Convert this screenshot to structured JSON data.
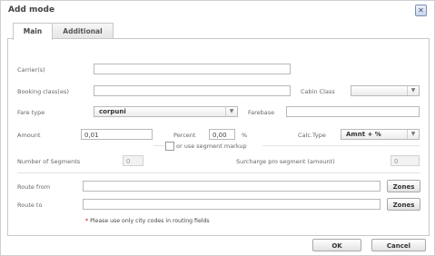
{
  "dialog": {
    "title": "Add mode",
    "close_symbol": "✕"
  },
  "tabs": [
    {
      "label": "Main",
      "active": true
    },
    {
      "label": "Additional",
      "active": false
    }
  ],
  "form": {
    "carriers_label": "Carrier(s)",
    "booking_label": "Booking class(es)",
    "cabin_class_label": "Cabin Class",
    "cabin_class_value": "",
    "fare_type_label": "Fare type",
    "fare_type_value": "corpuni",
    "farebase_label": "Farebase",
    "amount_label": "Amount",
    "amount_value": "0,01",
    "percent_label": "Percent",
    "percent_value": "0,00",
    "percent_unit": "%",
    "calc_type_label": "Calc.Type",
    "calc_type_value": "Amnt + %",
    "segment_markup_label": "or use segment markup",
    "num_segments_label": "Number of Segments",
    "num_segments_value": "0",
    "surcharge_label": "Surcharge pro segment (amount)",
    "surcharge_value": "0",
    "route_from_label": "Route from",
    "route_to_label": "Route to",
    "zones_label": "Zones",
    "note_star": "*",
    "note_text": "Please use only city codes in routing fields"
  },
  "footer": {
    "ok_label": "OK",
    "cancel_label": "Cancel"
  },
  "icons": {
    "dropdown": "chevron-down-icon",
    "close": "close-icon"
  }
}
